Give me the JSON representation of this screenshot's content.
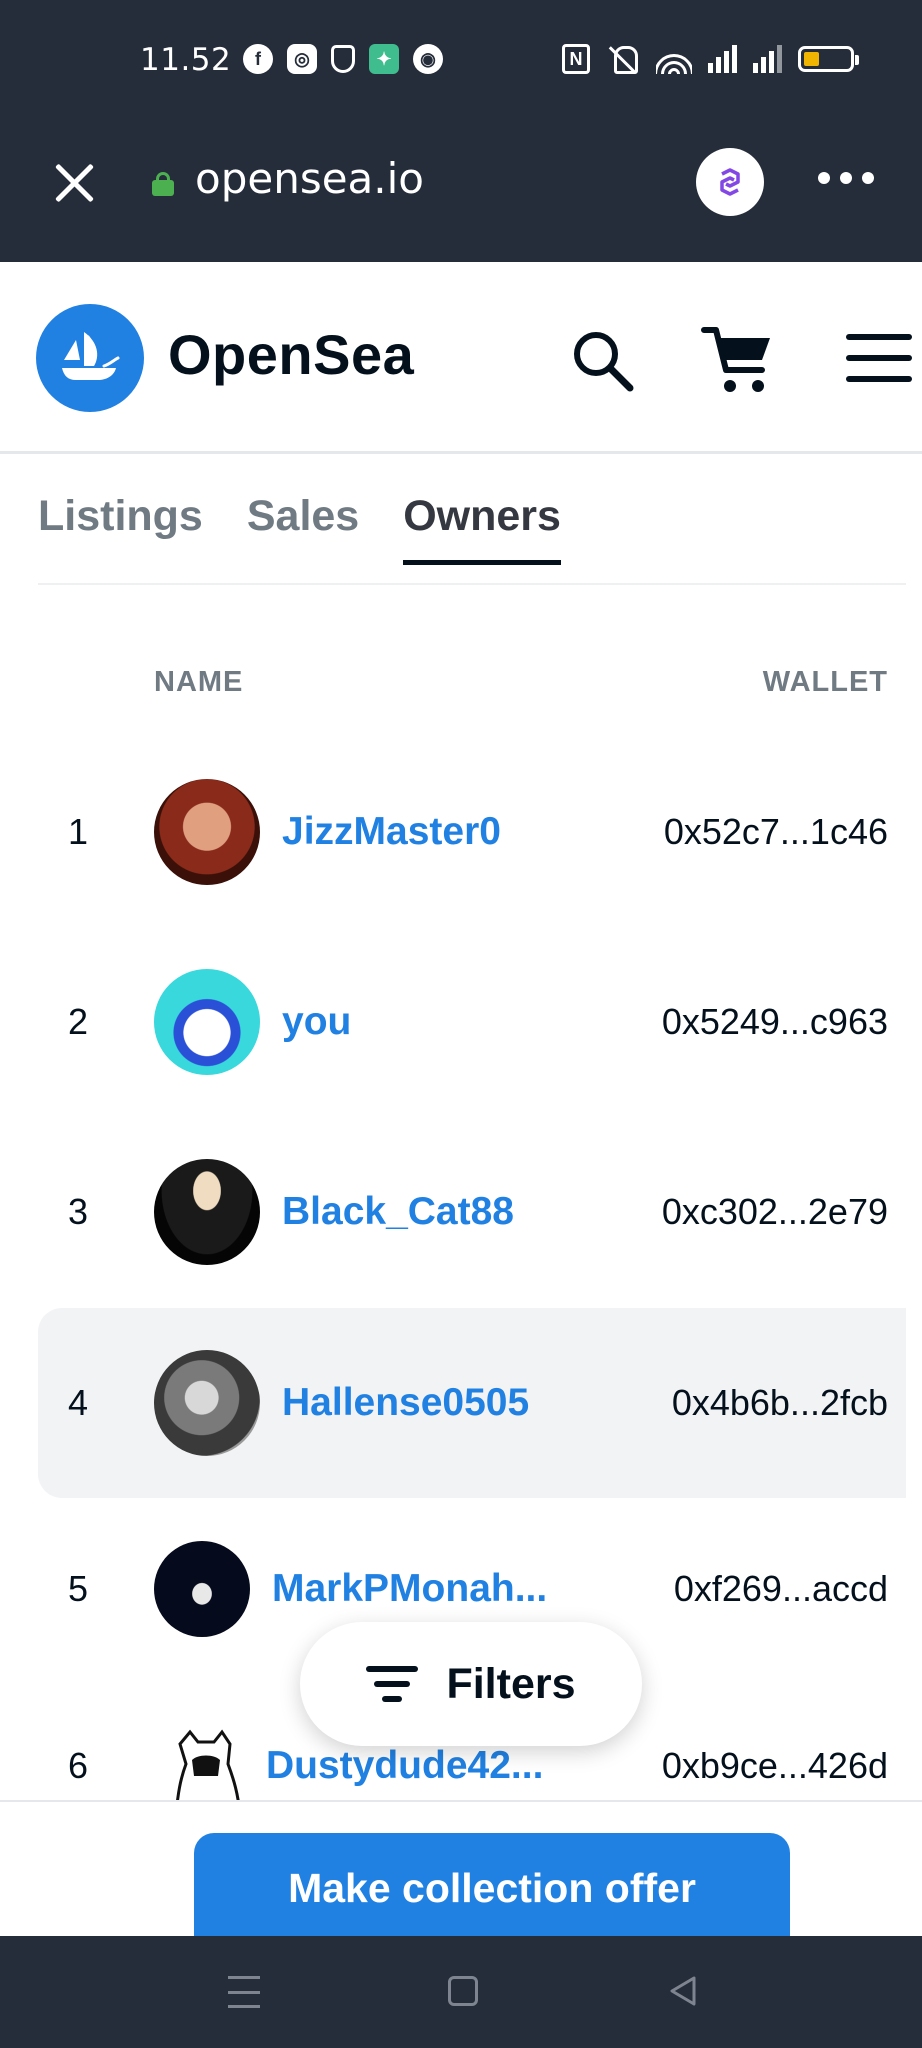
{
  "status_bar": {
    "time": "11.52",
    "battery_level": 0.35
  },
  "browser": {
    "url": "opensea.io",
    "icons": [
      "close-icon",
      "lock-icon",
      "polygon-icon",
      "more-icon"
    ]
  },
  "header": {
    "brand": "OpenSea",
    "icons": [
      "opensea-logo-icon",
      "search-icon",
      "cart-icon",
      "menu-icon"
    ]
  },
  "tabs": [
    {
      "label": "Listings",
      "active": false
    },
    {
      "label": "Sales",
      "active": false
    },
    {
      "label": "Owners",
      "active": true
    }
  ],
  "table": {
    "columns": {
      "name": "NAME",
      "wallet": "WALLET"
    },
    "rows": [
      {
        "rank": "1",
        "name": "JizzMaster0",
        "wallet": "0x52c7...1c46"
      },
      {
        "rank": "2",
        "name": "you",
        "wallet": "0x5249...c963"
      },
      {
        "rank": "3",
        "name": "Black_Cat88",
        "wallet": "0xc302...2e79"
      },
      {
        "rank": "4",
        "name": "Hallense0505",
        "wallet": "0x4b6b...2fcb"
      },
      {
        "rank": "5",
        "name": "MarkPMonah...",
        "wallet": "0xf269...accd"
      },
      {
        "rank": "6",
        "name": "Dustydude42...",
        "wallet": "0xb9ce...426d"
      }
    ]
  },
  "filters_button": {
    "label": "Filters"
  },
  "offer_button": {
    "label": "Make collection offer"
  },
  "colors": {
    "accent": "#2081e2",
    "dark_bar": "#252d3a",
    "highlight_row": "#f2f3f5"
  }
}
